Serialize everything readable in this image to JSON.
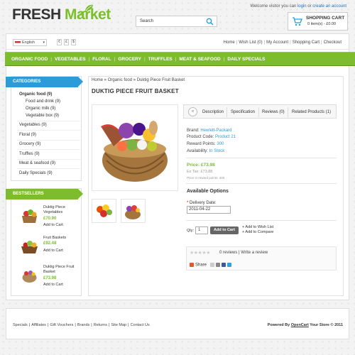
{
  "header": {
    "logo_part1": "FRESH",
    "logo_part2": "Market",
    "welcome_prefix": "Welcome visitor you can",
    "login_link": "login",
    "welcome_or": "or",
    "create_account_link": "create an account",
    "search_placeholder": "Search",
    "cart_title": "SHOPPING CART",
    "cart_summary": "0 item(s) - £0.00"
  },
  "topbar": {
    "language": "English",
    "currencies": [
      "€",
      "£",
      "$"
    ],
    "links": [
      "Home",
      "Wish List (0)",
      "My Account",
      "Shopping Cart",
      "Checkout"
    ]
  },
  "nav": {
    "items": [
      "ORGANIC FOOD",
      "VEGETABLES",
      "FLORAL",
      "GROCERY",
      "TRUFFLES",
      "MEAT & SEAFOOD",
      "DAILY SPECIALS"
    ]
  },
  "categories": {
    "title": "CATEGORIES",
    "items": [
      "Organic food (9)",
      "Food and drink (9)",
      "Organic milk (9)",
      "Vegetable box (9)",
      "Vegetables (9)",
      "Floral (9)",
      "Grocery (9)",
      "Truffles (9)",
      "Meat & seafood (9)",
      "Daily Specials (9)"
    ]
  },
  "bestsellers": {
    "title": "BESTSELLERS",
    "items": [
      {
        "name1": "Duktig Piece",
        "name2": "Vegetables",
        "price": "£70.90",
        "add": "Add to Cart"
      },
      {
        "name1": "Fruit Baskets",
        "name2": "",
        "price": "£92.48",
        "add": "Add to Cart"
      },
      {
        "name1": "Duktig Piece Fruit",
        "name2": "Basket",
        "price": "£73.98",
        "add": "Add to Cart"
      }
    ]
  },
  "product": {
    "breadcrumb": [
      "Home",
      "Organic food",
      "Duktig Piece Fruit Basket"
    ],
    "title": "DUKTIG PIECE FRUIT BASKET",
    "tabs": [
      "Description",
      "Specification",
      "Reviews (0)",
      "Related Products (1)"
    ],
    "brand_label": "Brand:",
    "brand": "Hewlett-Packard",
    "code_label": "Product Code:",
    "code": "Product 21",
    "reward_label": "Reward Points:",
    "reward": "300",
    "availability_label": "Availability:",
    "availability": "In Stock",
    "price": "Price: £73.98",
    "ex_tax": "Ex Tax: £73.88",
    "points": "Price in reward points: 400",
    "available_options": "Available Options",
    "delivery_label": "Delivery Date:",
    "delivery_value": "2011-04-22",
    "qty_label": "Qty:",
    "qty_value": "1",
    "add_to_cart": "Add to Cart",
    "add_wishlist": "+ Add to Wish List",
    "add_compare": "+ Add to Compare",
    "reviews": "0 reviews",
    "write_review": "Write a review",
    "share": "Share"
  },
  "footer": {
    "links": [
      "Specials",
      "Affiliates",
      "Gift Vouchers",
      "Brands",
      "Returns",
      "Site Map",
      "Contact Us"
    ],
    "powered_prefix": "Powered By",
    "powered_link": "OpenCart",
    "powered_suffix": "Your Store © 2011"
  },
  "colors": {
    "accent_green": "#7cbc2e",
    "accent_blue": "#2b9cd8"
  }
}
